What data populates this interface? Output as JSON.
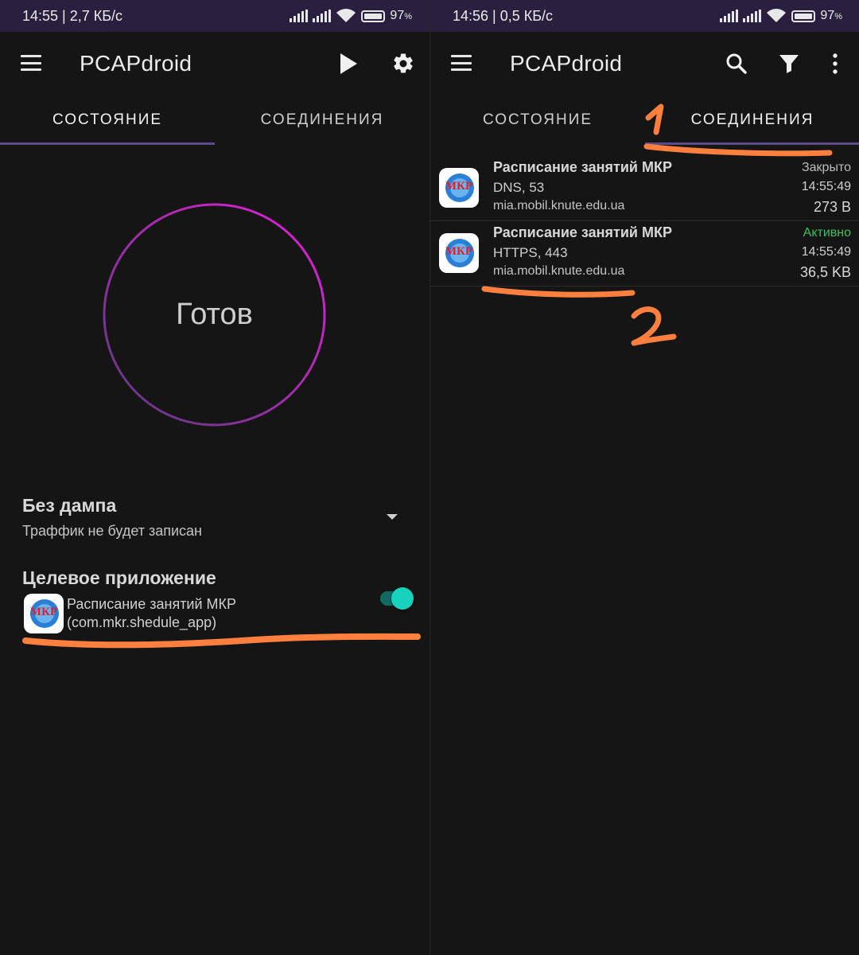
{
  "colors": {
    "statusbar_bg": "#2a1f3f",
    "background": "#151515",
    "tab_indicator": "#5a4a8c",
    "ring_start": "#e61fdc",
    "ring_end": "#5b3a7a",
    "toggle_on": "#18d3bb",
    "active_status": "#3fbf5f",
    "annotation": "#ff7f3f"
  },
  "left": {
    "statusbar": {
      "time": "14:55 | 2,7 КБ/с",
      "battery": "97",
      "battery_suffix": "%"
    },
    "appbar": {
      "title": "PCAPdroid",
      "icons": [
        "menu-icon",
        "play-icon",
        "gear-icon"
      ]
    },
    "tabs": [
      {
        "label": "СОСТОЯНИЕ",
        "active": true
      },
      {
        "label": "СОЕДИНЕНИЯ",
        "active": false
      }
    ],
    "status_circle": {
      "label": "Готов"
    },
    "dump_mode": {
      "title": "Без дампа",
      "subtitle": "Траффик не будет записан"
    },
    "target_app": {
      "title": "Целевое приложение",
      "app_name": "Расписание занятий МКР",
      "package": "(com.mkr.shedule_app)",
      "icon_text": "МКР",
      "enabled": true
    }
  },
  "right": {
    "statusbar": {
      "time": "14:56 | 0,5 КБ/с",
      "battery": "97",
      "battery_suffix": "%"
    },
    "appbar": {
      "title": "PCAPdroid",
      "icons": [
        "menu-icon",
        "search-icon",
        "filter-icon",
        "more-vert-icon"
      ]
    },
    "tabs": [
      {
        "label": "СОСТОЯНИЕ",
        "active": false
      },
      {
        "label": "СОЕДИНЕНИЯ",
        "active": true
      }
    ],
    "connections": [
      {
        "app": "Расписание занятий МКР",
        "proto": "DNS, 53",
        "host": "mia.mobil.knute.edu.ua",
        "status": "Закрыто",
        "time": "14:55:49",
        "size": "273 B",
        "icon_text": "МКР"
      },
      {
        "app": "Расписание занятий МКР",
        "proto": "HTTPS, 443",
        "host": "mia.mobil.knute.edu.ua",
        "status": "Активно",
        "time": "14:55:49",
        "size": "36,5 KB",
        "icon_text": "МКР"
      }
    ]
  },
  "annotations": {
    "mark_1": "1",
    "mark_2": "2"
  }
}
